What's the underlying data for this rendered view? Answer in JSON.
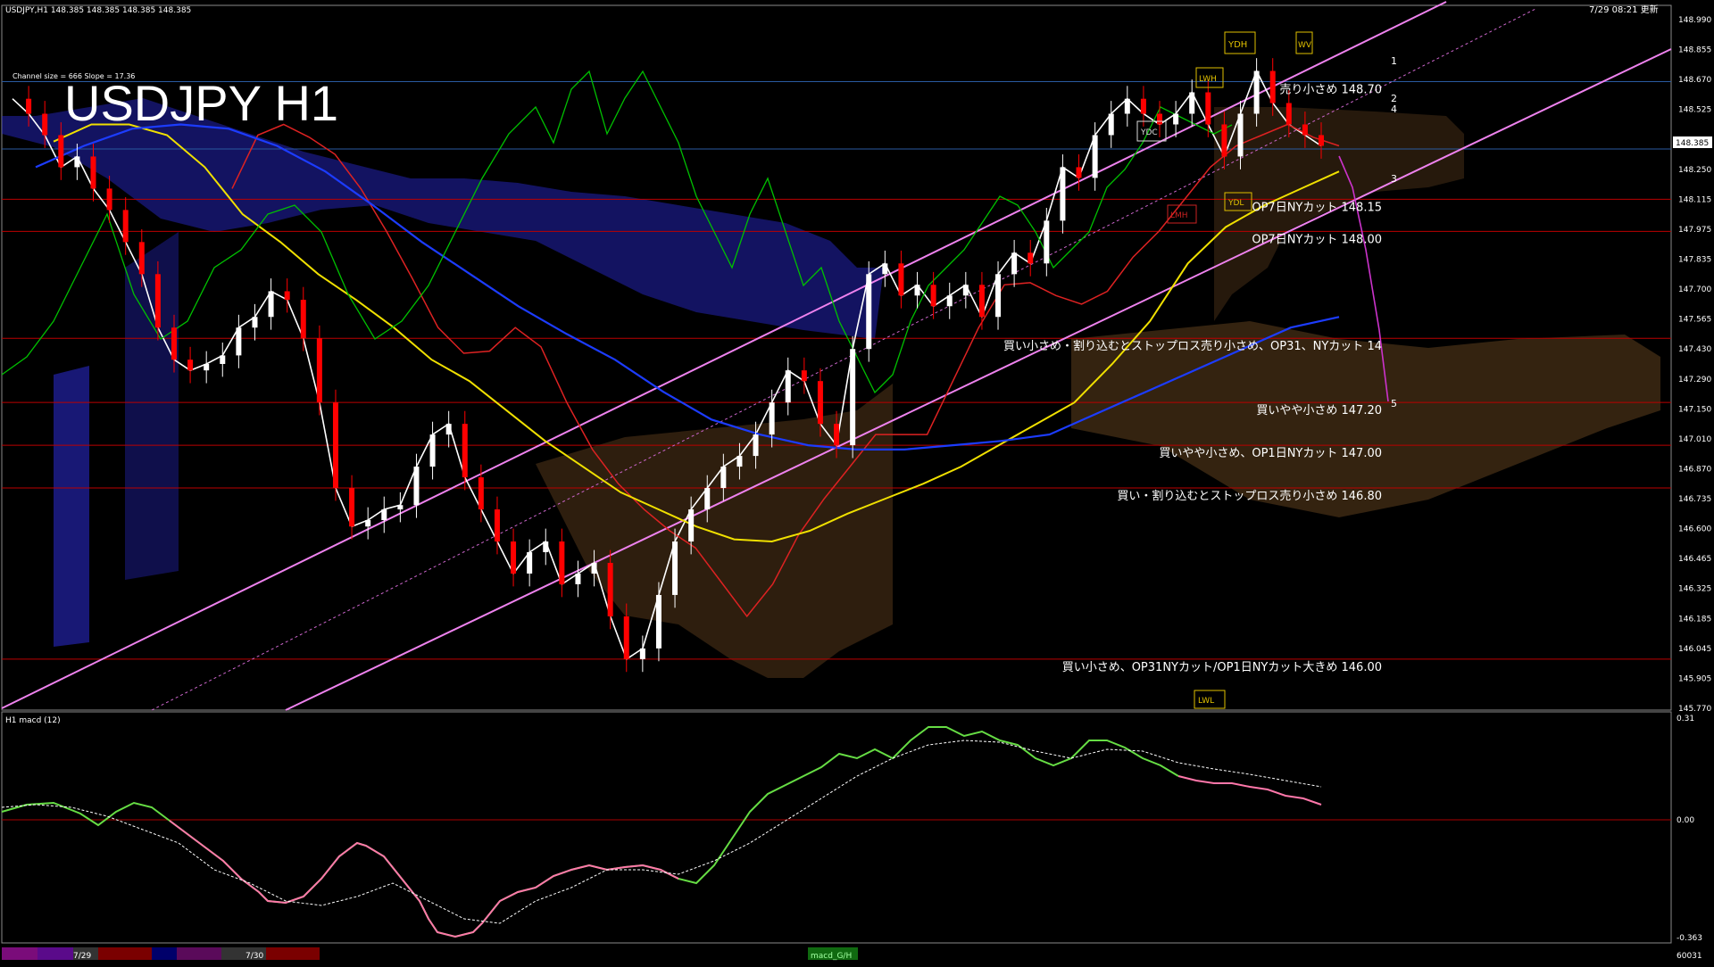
{
  "header": {
    "symbol_info": "USDJPY,H1  148.385 148.385 148.385 148.385",
    "update_info": "7/29 08:21 更新",
    "indicator_label": "Channel size = 666 Slope = 17.36"
  },
  "chart_title": "USDJPY H1",
  "price_axis": {
    "ticks": [
      "148.990",
      "148.855",
      "148.670",
      "148.525",
      "148.385",
      "148.250",
      "148.115",
      "147.975",
      "147.835",
      "147.700",
      "147.565",
      "147.430",
      "147.290",
      "147.150",
      "147.010",
      "146.870",
      "146.735",
      "146.600",
      "146.465",
      "146.325",
      "146.185",
      "146.045",
      "145.905",
      "145.770"
    ],
    "current_price": "148.385"
  },
  "colors": {
    "background": "#000000",
    "bull_candle": "#ffffff",
    "bear_candle": "#ff0000",
    "cloud_blue": "#2b2bd6",
    "cloud_orange": "#d08a40",
    "ma_white": "#ffffff",
    "ma_yellow": "#f0e000",
    "ma_blue": "#1c3cff",
    "channel_pink": "#ee82ee",
    "chikou_green": "#00c000",
    "macd_up": "#66dd44",
    "macd_down": "#ff77aa"
  },
  "annotations": [
    {
      "text": "売り小さめ 148.70",
      "price": 148.7
    },
    {
      "text": "OP7日NYカット 148.15",
      "price": 148.15
    },
    {
      "text": "OP7日NYカット 148.00",
      "price": 148.0
    },
    {
      "text": "買い小さめ・割り込むとストップロス売り小さめ、OP31、NYカット 14",
      "price": 147.5
    },
    {
      "text": "買いやや小さめ 147.20",
      "price": 147.2
    },
    {
      "text": "買いやや小さめ、OP1日NYカット 147.00",
      "price": 147.0
    },
    {
      "text": "買い・割り込むとストップロス売り小さめ 146.80",
      "price": 146.8
    },
    {
      "text": "買い小さめ、OP31NYカット/OP1日NYカット大きめ 146.00",
      "price": 146.0
    }
  ],
  "level_boxes": [
    "YDH",
    "WV",
    "LWH",
    "YDC",
    "YDL",
    "LMH",
    "LWL"
  ],
  "scenario_labels": [
    "1",
    "2",
    "4",
    "3",
    "5"
  ],
  "macd": {
    "label": "H1  macd (12)",
    "ticks": [
      "0.31",
      "0.00",
      "-0.363"
    ],
    "footer_right": "60031"
  },
  "time_axis": {
    "labels": [
      "7/29",
      "7/30"
    ],
    "center_label": "macd_G/H"
  },
  "chart_data": {
    "type": "line",
    "title": "USDJPY H1",
    "ylim": [
      145.77,
      148.99
    ],
    "horizontal_levels": [
      148.7,
      148.15,
      148.0,
      147.5,
      147.2,
      147.0,
      146.8,
      146.0
    ],
    "series": [
      {
        "values": [
          148.62,
          148.55,
          148.45,
          148.3,
          148.35,
          148.2,
          148.1,
          147.95,
          147.8,
          147.55,
          147.4,
          147.35,
          147.38,
          147.42,
          147.55,
          147.6,
          147.72,
          147.68,
          147.5,
          147.2,
          146.8,
          146.62,
          146.65,
          146.7,
          146.72,
          146.9,
          147.05,
          147.1,
          146.85,
          146.7,
          146.55,
          146.4,
          146.5,
          146.55,
          146.35,
          146.4,
          146.45,
          146.2,
          146.0,
          146.05,
          146.3,
          146.55,
          146.7,
          146.8,
          146.9,
          146.95,
          147.05,
          147.2,
          147.35,
          147.3,
          147.1,
          147.0,
          147.45,
          147.8,
          147.85,
          147.7,
          147.75,
          147.65,
          147.7,
          147.75,
          147.6,
          147.8,
          147.9,
          147.85,
          148.05,
          148.3,
          148.25,
          148.45,
          148.55,
          148.62,
          148.55,
          148.5,
          148.55,
          148.65,
          148.5,
          148.35,
          148.55,
          148.75,
          148.6,
          148.5,
          148.45,
          148.4
        ]
      },
      {
        "values": [
          148.2,
          148.45,
          148.5,
          148.44,
          148.36,
          148.2,
          148.0,
          147.78,
          147.55,
          147.43,
          147.44,
          147.55,
          147.46,
          147.2,
          146.98,
          146.82,
          146.7,
          146.6,
          146.52,
          146.36,
          146.2,
          146.35,
          146.58,
          146.75,
          146.9,
          147.05,
          147.05,
          147.05,
          147.3,
          147.55,
          147.75,
          147.76,
          147.7,
          147.66,
          147.72,
          147.88,
          148.0,
          148.15,
          148.3,
          148.4,
          148.45,
          148.5,
          148.44,
          148.4
        ]
      },
      {
        "values": [
          148.42,
          148.5,
          148.5,
          148.45,
          148.3,
          148.08,
          147.95,
          147.8,
          147.68,
          147.55,
          147.4,
          147.3,
          147.16,
          147.02,
          146.9,
          146.78,
          146.7,
          146.62,
          146.56,
          146.55,
          146.6,
          146.68,
          146.75,
          146.82,
          146.9,
          147.0,
          147.1,
          147.2,
          147.38,
          147.58,
          147.85,
          148.02,
          148.12,
          148.2,
          148.28
        ]
      },
      {
        "values": [
          148.3,
          148.4,
          148.48,
          148.5,
          148.48,
          148.4,
          148.28,
          148.12,
          147.95,
          147.8,
          147.65,
          147.52,
          147.4,
          147.25,
          147.12,
          147.05,
          147.0,
          146.98,
          146.98,
          147.0,
          147.02,
          147.05,
          147.15,
          147.25,
          147.35,
          147.45,
          147.55,
          147.6
        ]
      }
    ]
  }
}
